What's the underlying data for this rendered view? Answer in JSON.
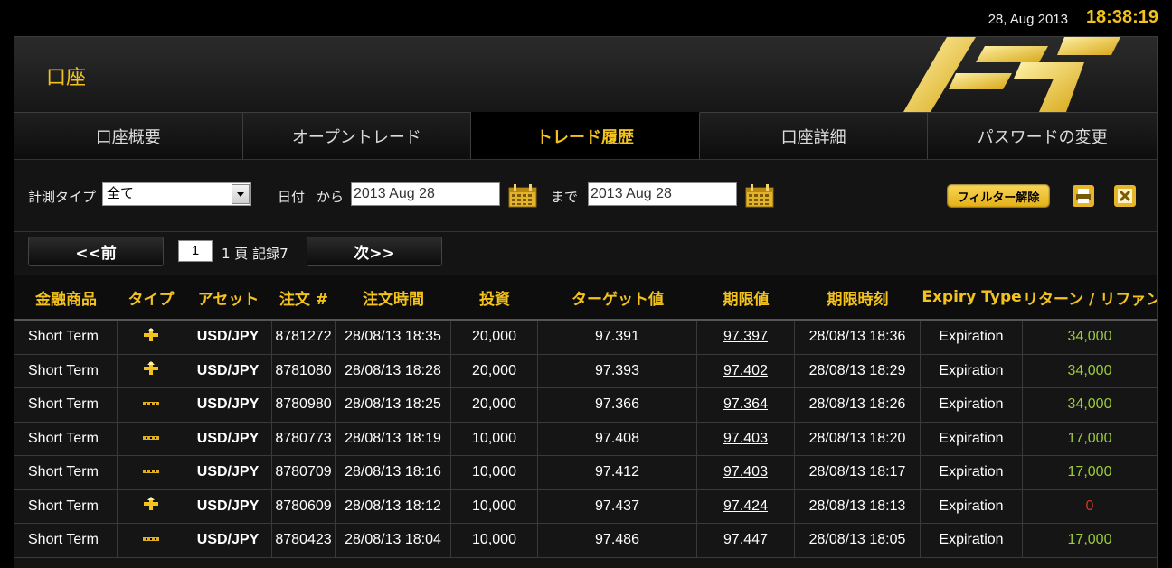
{
  "topbar": {
    "date": "28, Aug 2013",
    "time": "18:38:19"
  },
  "header": {
    "title": "口座"
  },
  "tabs": [
    {
      "label": "口座概要",
      "active": false
    },
    {
      "label": "オープントレード",
      "active": false
    },
    {
      "label": "トレード履歴",
      "active": true
    },
    {
      "label": "口座詳細",
      "active": false
    },
    {
      "label": "パスワードの変更",
      "active": false
    }
  ],
  "filters": {
    "type_label": "計測タイプ",
    "type_value": "全て",
    "date_label": "日付",
    "from_label": "から",
    "from_value": "2013 Aug 28",
    "to_label": "まで",
    "to_value": "2013 Aug 28",
    "clear_button": "フィルター解除"
  },
  "pager": {
    "prev_label": "<<前",
    "page_value": "1",
    "info": "1 頁 記録7",
    "next_label": "次>>"
  },
  "table": {
    "headers": [
      "金融商品",
      "タイプ",
      "アセット",
      "注文 #",
      "注文時間",
      "投資",
      "ターゲット値",
      "期限値",
      "期限時刻",
      "Expiry Type",
      "リターン / リファンド"
    ],
    "rows": [
      {
        "instrument": "Short Term",
        "type": "up",
        "asset": "USD/JPY",
        "order": "8781272",
        "order_time": "28/08/13 18:35",
        "investment": "20,000",
        "target": "97.391",
        "expiry_value": "97.397",
        "expiry_time": "28/08/13 18:36",
        "expiry_type": "Expiration",
        "return": "34,000"
      },
      {
        "instrument": "Short Term",
        "type": "up",
        "asset": "USD/JPY",
        "order": "8781080",
        "order_time": "28/08/13 18:28",
        "investment": "20,000",
        "target": "97.393",
        "expiry_value": "97.402",
        "expiry_time": "28/08/13 18:29",
        "expiry_type": "Expiration",
        "return": "34,000"
      },
      {
        "instrument": "Short Term",
        "type": "down",
        "asset": "USD/JPY",
        "order": "8780980",
        "order_time": "28/08/13 18:25",
        "investment": "20,000",
        "target": "97.366",
        "expiry_value": "97.364",
        "expiry_time": "28/08/13 18:26",
        "expiry_type": "Expiration",
        "return": "34,000"
      },
      {
        "instrument": "Short Term",
        "type": "down",
        "asset": "USD/JPY",
        "order": "8780773",
        "order_time": "28/08/13 18:19",
        "investment": "10,000",
        "target": "97.408",
        "expiry_value": "97.403",
        "expiry_time": "28/08/13 18:20",
        "expiry_type": "Expiration",
        "return": "17,000"
      },
      {
        "instrument": "Short Term",
        "type": "down",
        "asset": "USD/JPY",
        "order": "8780709",
        "order_time": "28/08/13 18:16",
        "investment": "10,000",
        "target": "97.412",
        "expiry_value": "97.403",
        "expiry_time": "28/08/13 18:17",
        "expiry_type": "Expiration",
        "return": "17,000"
      },
      {
        "instrument": "Short Term",
        "type": "up",
        "asset": "USD/JPY",
        "order": "8780609",
        "order_time": "28/08/13 18:12",
        "investment": "10,000",
        "target": "97.437",
        "expiry_value": "97.424",
        "expiry_time": "28/08/13 18:13",
        "expiry_type": "Expiration",
        "return": "0"
      },
      {
        "instrument": "Short Term",
        "type": "down",
        "asset": "USD/JPY",
        "order": "8780423",
        "order_time": "28/08/13 18:04",
        "investment": "10,000",
        "target": "97.486",
        "expiry_value": "97.447",
        "expiry_time": "28/08/13 18:05",
        "expiry_type": "Expiration",
        "return": "17,000"
      }
    ]
  },
  "colors": {
    "accent": "#f3c21d",
    "positive": "#9ccc3b",
    "negative": "#d23a1f"
  }
}
